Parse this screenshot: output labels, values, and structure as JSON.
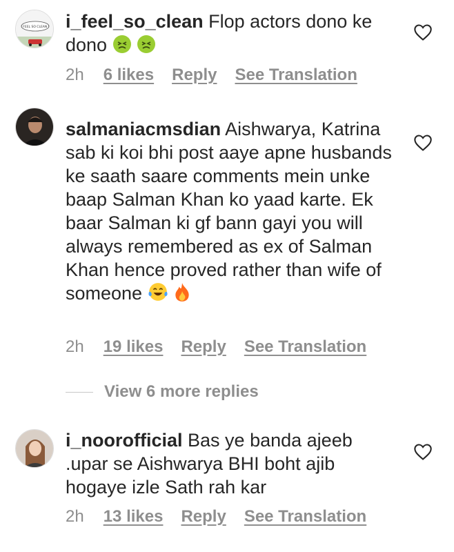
{
  "comments": [
    {
      "username": "i_feel_so_clean",
      "text": "Flop actors dono ke dono",
      "time": "2h",
      "likes": "6 likes",
      "reply": "Reply",
      "translate": "See Translation",
      "avatar_caption": "I FEEL SO CLEAN !"
    },
    {
      "username": "salmaniacmsdian",
      "text": "Aishwarya, Katrina sab ki koi bhi post aaye apne husbands ke saath saare comments mein unke baap Salman Khan ko yaad karte. Ek baar Salman ki gf bann gayi you will always remembered as ex of Salman Khan hence proved rather than wife of someone",
      "time": "2h",
      "likes": "19 likes",
      "reply": "Reply",
      "translate": "See Translation"
    },
    {
      "username": "i_noorofficial",
      "text": "Bas ye banda ajeeb .upar se Aishwarya BHI boht ajib hogaye izle Sath rah kar",
      "time": "2h",
      "likes": "13 likes",
      "reply": "Reply",
      "translate": "See Translation"
    }
  ],
  "view_more": "View 6 more replies",
  "icons": {
    "heart": "heart-outline-icon",
    "nauseated": "nauseated-face-emoji",
    "laughing": "tears-of-joy-emoji",
    "fire": "fire-emoji"
  },
  "colors": {
    "text": "#262626",
    "muted": "#8e8e8e"
  }
}
